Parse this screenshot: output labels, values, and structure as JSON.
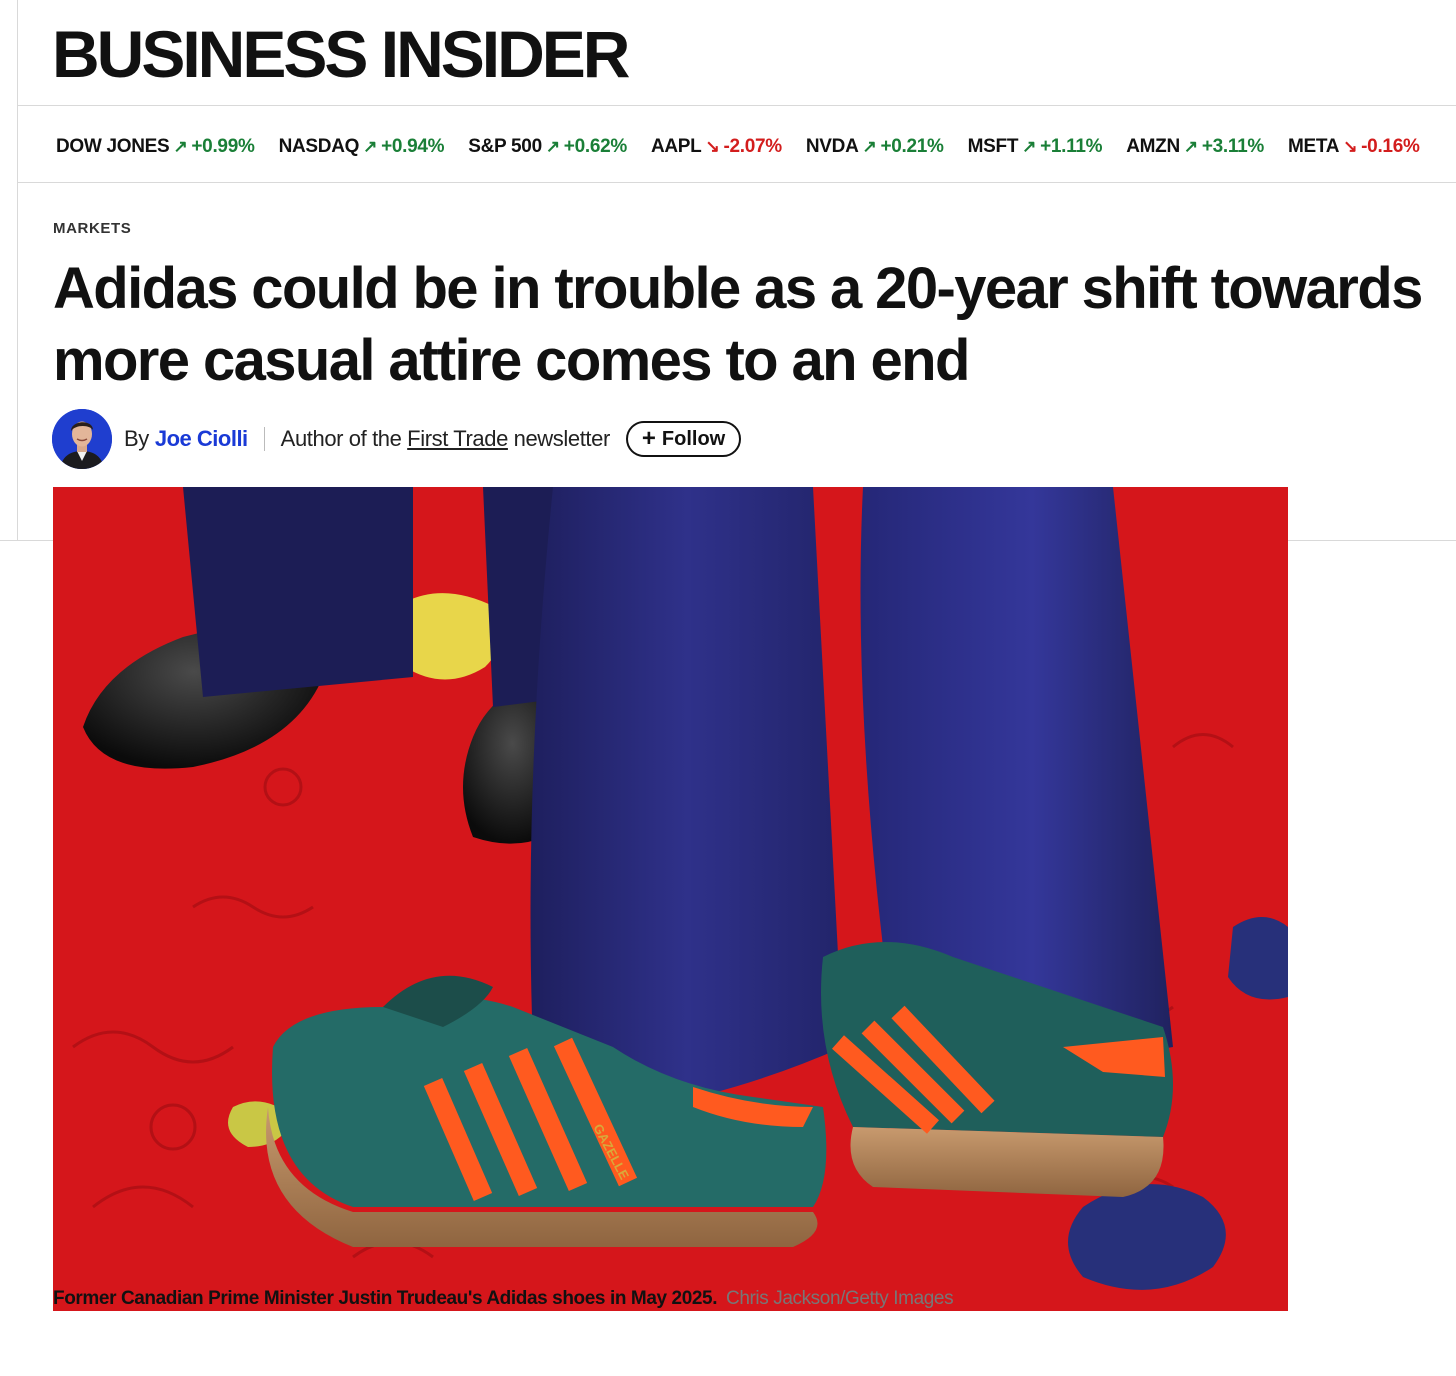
{
  "brand": {
    "logo_text": "BUSINESS INSIDER"
  },
  "ticker": [
    {
      "name": "DOW JONES",
      "change": "+0.99%",
      "direction": "up"
    },
    {
      "name": "NASDAQ",
      "change": "+0.94%",
      "direction": "up"
    },
    {
      "name": "S&P 500",
      "change": "+0.62%",
      "direction": "up"
    },
    {
      "name": "AAPL",
      "change": "-2.07%",
      "direction": "down"
    },
    {
      "name": "NVDA",
      "change": "+0.21%",
      "direction": "up"
    },
    {
      "name": "MSFT",
      "change": "+1.11%",
      "direction": "up"
    },
    {
      "name": "AMZN",
      "change": "+3.11%",
      "direction": "up"
    },
    {
      "name": "META",
      "change": "-0.16%",
      "direction": "down"
    }
  ],
  "colors": {
    "up": "#1a7f37",
    "down": "#d31d1d",
    "author_link": "#1a3ad6"
  },
  "article": {
    "category": "MARKETS",
    "headline_line1": "Adidas could be in trouble as a 20-year shift towards",
    "headline_line2": "more casual attire comes to an end",
    "byline": {
      "by": "By",
      "author": "Joe Ciolli",
      "role_prefix": "Author of the",
      "newsletter": "First Trade",
      "role_suffix": "newsletter",
      "follow_label": "Follow",
      "follow_icon": "plus-icon"
    },
    "image_caption": "Former Canadian Prime Minister Justin Trudeau's Adidas shoes in May 2025.",
    "image_credit": "Chris Jackson/Getty Images",
    "shoe_lettering": "GAZELLE"
  }
}
